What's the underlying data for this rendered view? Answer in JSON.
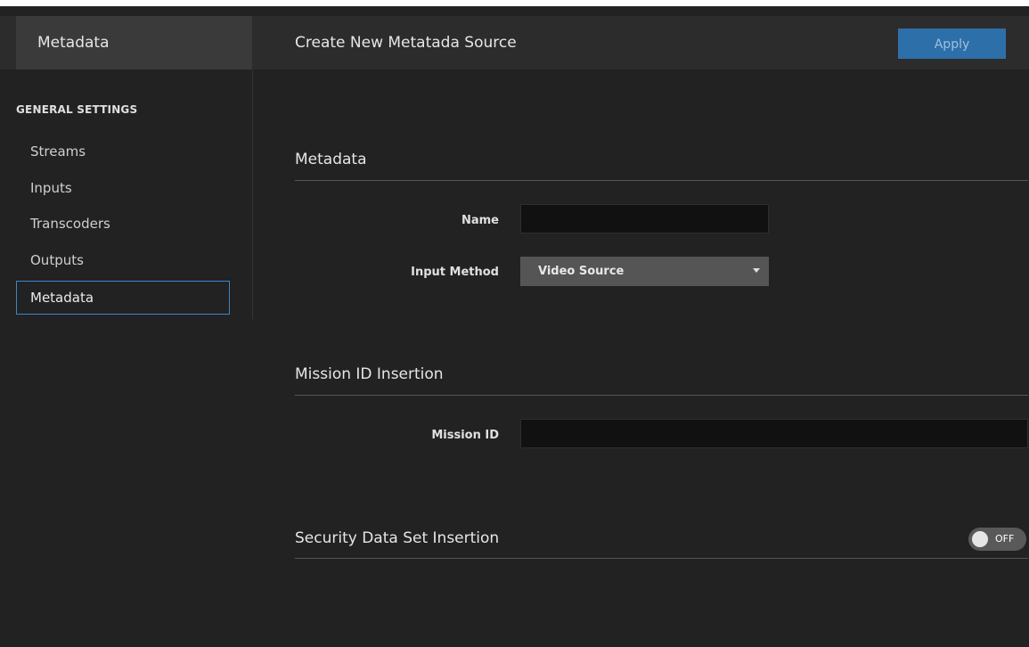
{
  "header": {
    "sidebar_title": "Metadata",
    "page_title": "Create New Metatada Source",
    "apply_label": "Apply"
  },
  "sidebar": {
    "section_header": "GENERAL SETTINGS",
    "items": [
      {
        "label": "Streams",
        "active": false
      },
      {
        "label": "Inputs",
        "active": false
      },
      {
        "label": "Transcoders",
        "active": false
      },
      {
        "label": "Outputs",
        "active": false
      },
      {
        "label": "Metadata",
        "active": true
      }
    ]
  },
  "metadata_section": {
    "title": "Metadata",
    "name_label": "Name",
    "name_value": "",
    "input_method_label": "Input Method",
    "input_method_value": "Video Source"
  },
  "mission_section": {
    "title": "Mission ID Insertion",
    "mission_id_label": "Mission ID",
    "mission_id_value": ""
  },
  "security_section": {
    "title": "Security Data Set Insertion",
    "toggle_label": "OFF",
    "toggle_on": false
  },
  "colors": {
    "background": "#222222",
    "accent": "#3a86c8",
    "apply_button": "#2d6fa9"
  }
}
